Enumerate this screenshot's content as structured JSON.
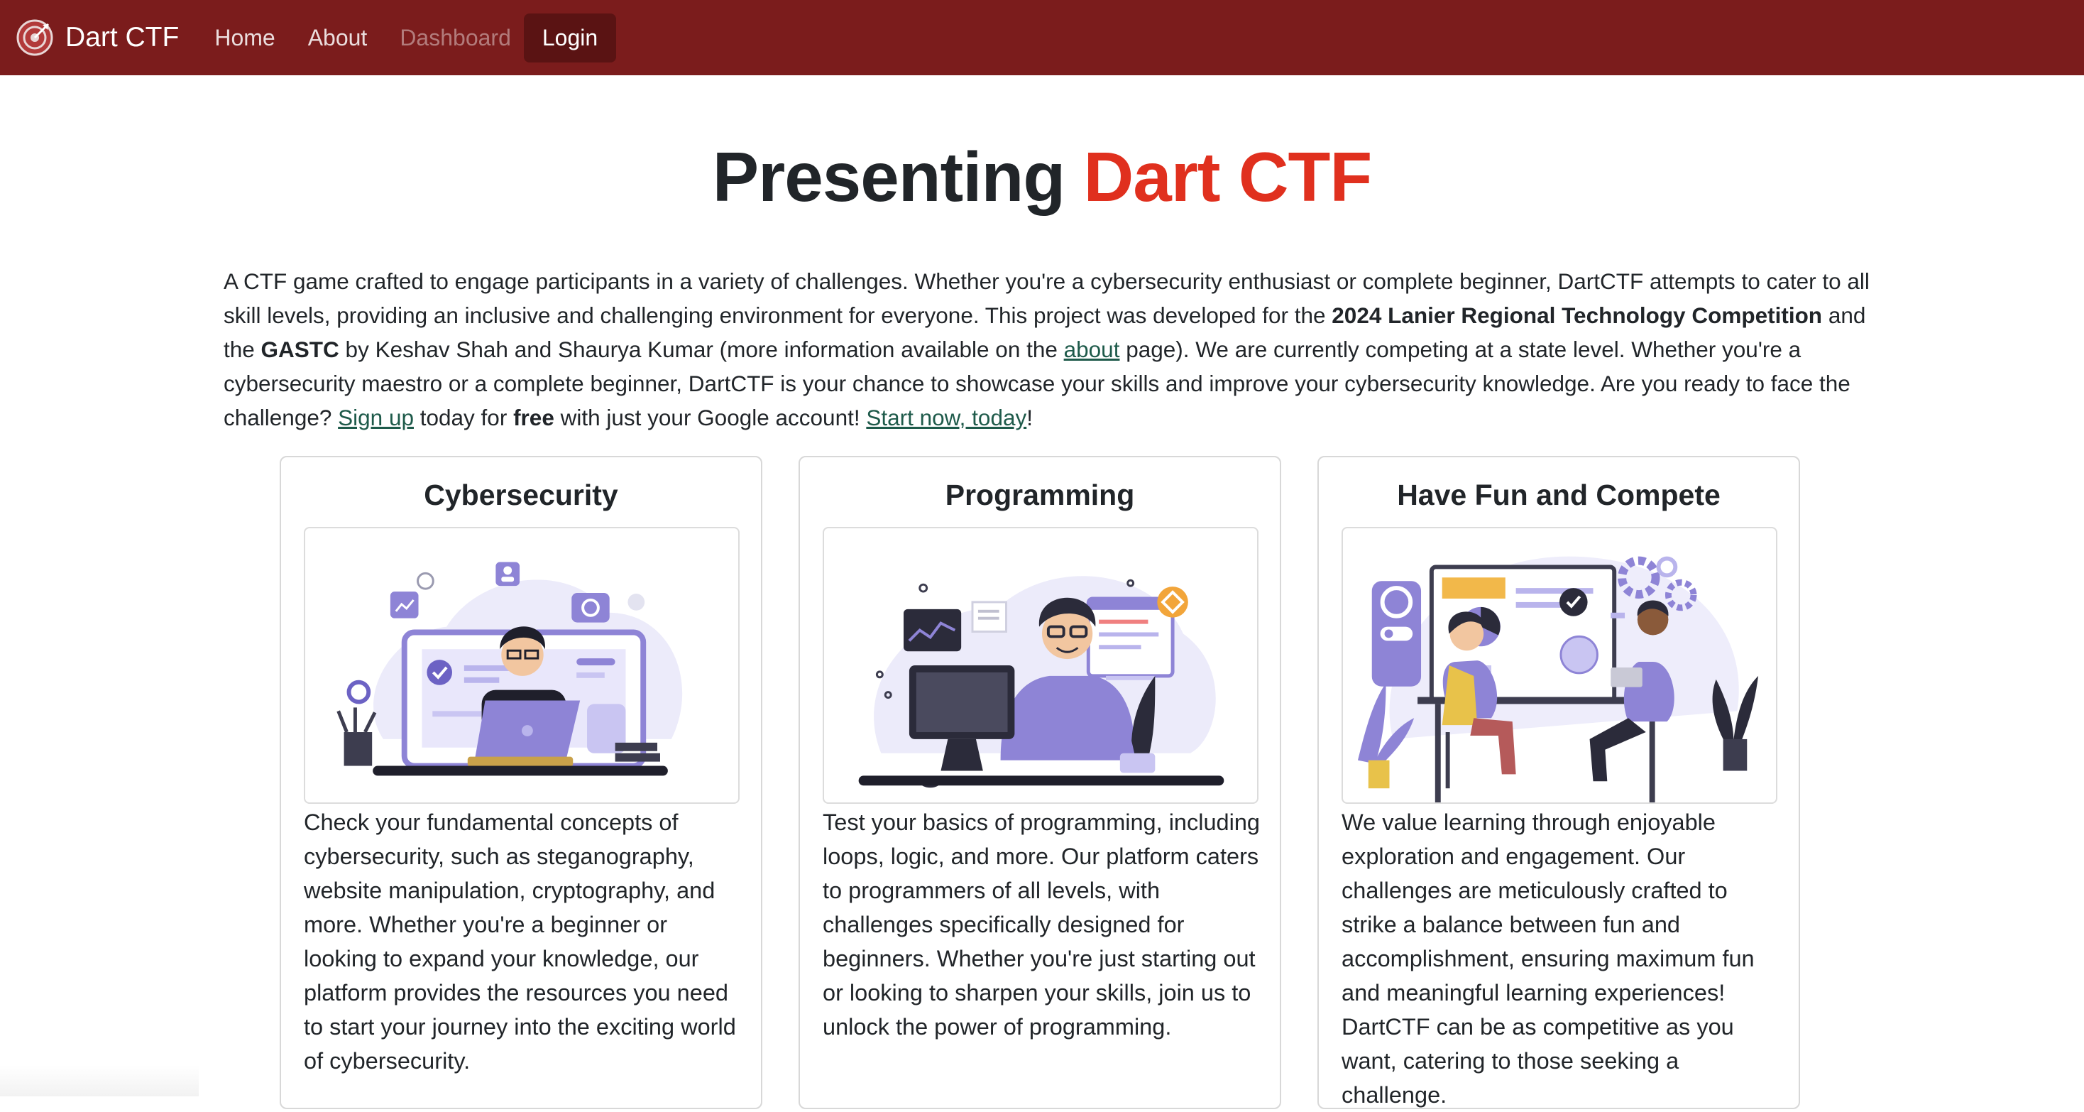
{
  "navbar": {
    "brand": "Dart CTF",
    "brand_icon": "target-icon",
    "background": "#7b1c1c",
    "links": [
      {
        "label": "Home",
        "state": "normal"
      },
      {
        "label": "About",
        "state": "normal"
      },
      {
        "label": "Dashboard",
        "state": "disabled"
      },
      {
        "label": "Login",
        "state": "active"
      }
    ]
  },
  "hero": {
    "title_prefix": "Presenting ",
    "title_highlight": "Dart CTF",
    "highlight_color": "#e0301e"
  },
  "intro": {
    "t1": "A CTF game crafted to engage participants in a variety of challenges. Whether you're a cybersecurity enthusiast or complete beginner, DartCTF attempts to cater to all skill levels, providing an inclusive and challenging environment for everyone. This project was developed for the ",
    "b1": "2024 Lanier Regional Technology Competition",
    "t2": " and the ",
    "b2": "GASTC",
    "t3": " by Keshav Shah and Shaurya Kumar (more information available on the ",
    "about_link": "about",
    "t4": " page). We are currently competing at a state level. Whether you're a cybersecurity maestro or a complete beginner, DartCTF is your chance to showcase your skills and improve your cybersecurity knowledge. Are you ready to face the challenge? ",
    "signup_link": "Sign up",
    "t5": " today for ",
    "b3": "free",
    "t6": " with just your Google account! ",
    "start_link": "Start now, today",
    "t7": "!"
  },
  "cards": [
    {
      "title": "Cybersecurity",
      "text": "Check your fundamental concepts of cybersecurity, such as steganography, website manipulation, cryptography, and more. Whether you're a beginner or looking to expand your knowledge, our platform provides the resources you need to start your journey into the exciting world of cybersecurity."
    },
    {
      "title": "Programming",
      "text": "Test your basics of programming, including loops, logic, and more. Our platform caters to programmers of all levels, with challenges specifically designed for beginners. Whether you're just starting out or looking to sharpen your skills, join us to unlock the power of programming."
    },
    {
      "title": "Have Fun and Compete",
      "text": "We value learning through enjoyable exploration and engagement. Our challenges are meticulously crafted to strike a balance between fun and accomplishment, ensuring maximum fun and meaningful learning experiences! DartCTF can be as competitive as you want, catering to those seeking a challenge."
    }
  ],
  "colors": {
    "link": "#1e5a4a",
    "illustration_purple": "#8e84d6",
    "illustration_dark": "#2b2b3a"
  }
}
